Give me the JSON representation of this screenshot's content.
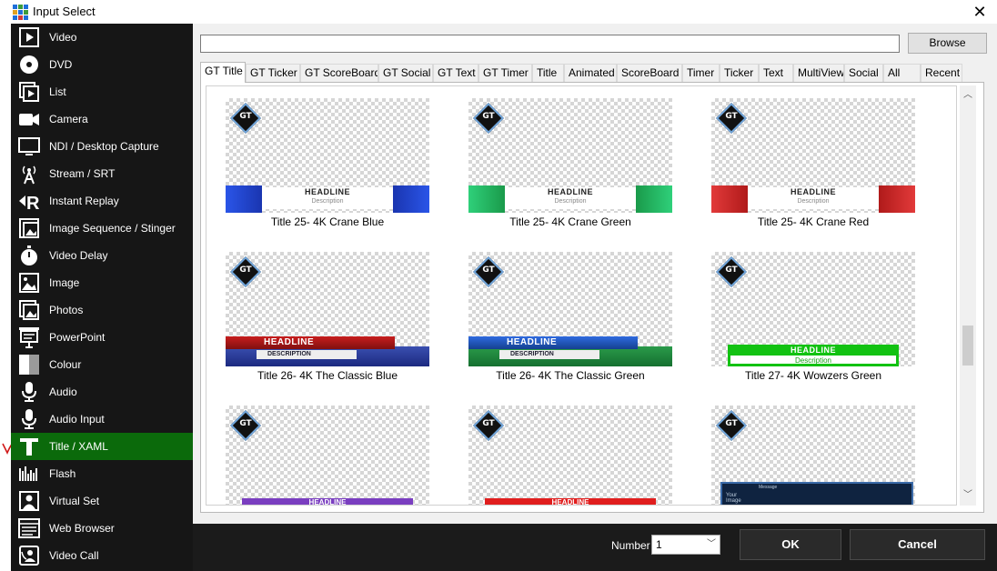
{
  "window": {
    "title": "Input Select",
    "close_glyph": "✕"
  },
  "sidebar": {
    "items": [
      {
        "label": "Video",
        "icon": "video-icon"
      },
      {
        "label": "DVD",
        "icon": "dvd-icon"
      },
      {
        "label": "List",
        "icon": "list-icon"
      },
      {
        "label": "Camera",
        "icon": "camera-icon"
      },
      {
        "label": "NDI / Desktop Capture",
        "icon": "monitor-icon"
      },
      {
        "label": "Stream / SRT",
        "icon": "antenna-icon"
      },
      {
        "label": "Instant Replay",
        "icon": "replay-icon"
      },
      {
        "label": "Image Sequence / Stinger",
        "icon": "image-sequence-icon"
      },
      {
        "label": "Video Delay",
        "icon": "stopwatch-icon"
      },
      {
        "label": "Image",
        "icon": "image-icon"
      },
      {
        "label": "Photos",
        "icon": "photos-icon"
      },
      {
        "label": "PowerPoint",
        "icon": "presentation-icon"
      },
      {
        "label": "Colour",
        "icon": "colour-icon"
      },
      {
        "label": "Audio",
        "icon": "microphone-icon"
      },
      {
        "label": "Audio Input",
        "icon": "audio-input-icon"
      },
      {
        "label": "Title / XAML",
        "icon": "title-icon",
        "selected": true
      },
      {
        "label": "Flash",
        "icon": "flash-icon"
      },
      {
        "label": "Virtual Set",
        "icon": "virtual-set-icon"
      },
      {
        "label": "Web Browser",
        "icon": "web-browser-icon"
      },
      {
        "label": "Video Call",
        "icon": "video-call-icon"
      }
    ],
    "selected_color": "#0b6a0b"
  },
  "path_input": {
    "value": ""
  },
  "browse_label": "Browse",
  "tabs": [
    "GT Title",
    "GT Ticker",
    "GT ScoreBoard",
    "GT Social",
    "GT Text",
    "GT Timer",
    "Title",
    "Animated",
    "ScoreBoard",
    "Timer",
    "Ticker",
    "Text",
    "MultiView",
    "Social",
    "All",
    "Recent"
  ],
  "active_tab": "GT Title",
  "logo_text": "GT",
  "tiles": [
    {
      "caption": "Title 25- 4K Crane Blue",
      "headline": "HEADLINE",
      "description": "Description",
      "accent": "#2a55e8"
    },
    {
      "caption": "Title 25- 4K Crane Green",
      "headline": "HEADLINE",
      "description": "Description",
      "accent": "#2fd07a"
    },
    {
      "caption": "Title 25- 4K Crane Red",
      "headline": "HEADLINE",
      "description": "Description",
      "accent": "#e23a3a"
    },
    {
      "caption": "Title 26- 4K The Classic Blue",
      "headline": "HEADLINE",
      "description": "DESCRIPTION",
      "accent": "#c81e1e"
    },
    {
      "caption": "Title 26- 4K The Classic Green",
      "headline": "HEADLINE",
      "description": "DESCRIPTION",
      "accent": "#1d5ec8"
    },
    {
      "caption": "Title 27- 4K Wowzers Green",
      "headline": "HEADLINE",
      "description": "Description",
      "accent": "#12c212"
    },
    {
      "caption": "",
      "headline": "HEADLINE",
      "accent": "#7a3ec0"
    },
    {
      "caption": "",
      "headline": "HEADLINE",
      "accent": "#e01e1e"
    },
    {
      "caption": "",
      "message": "Message",
      "your_image": "Your Image",
      "accent": "#0f2340"
    }
  ],
  "number": {
    "label": "Number",
    "value": "1"
  },
  "ok_label": "OK",
  "cancel_label": "Cancel"
}
